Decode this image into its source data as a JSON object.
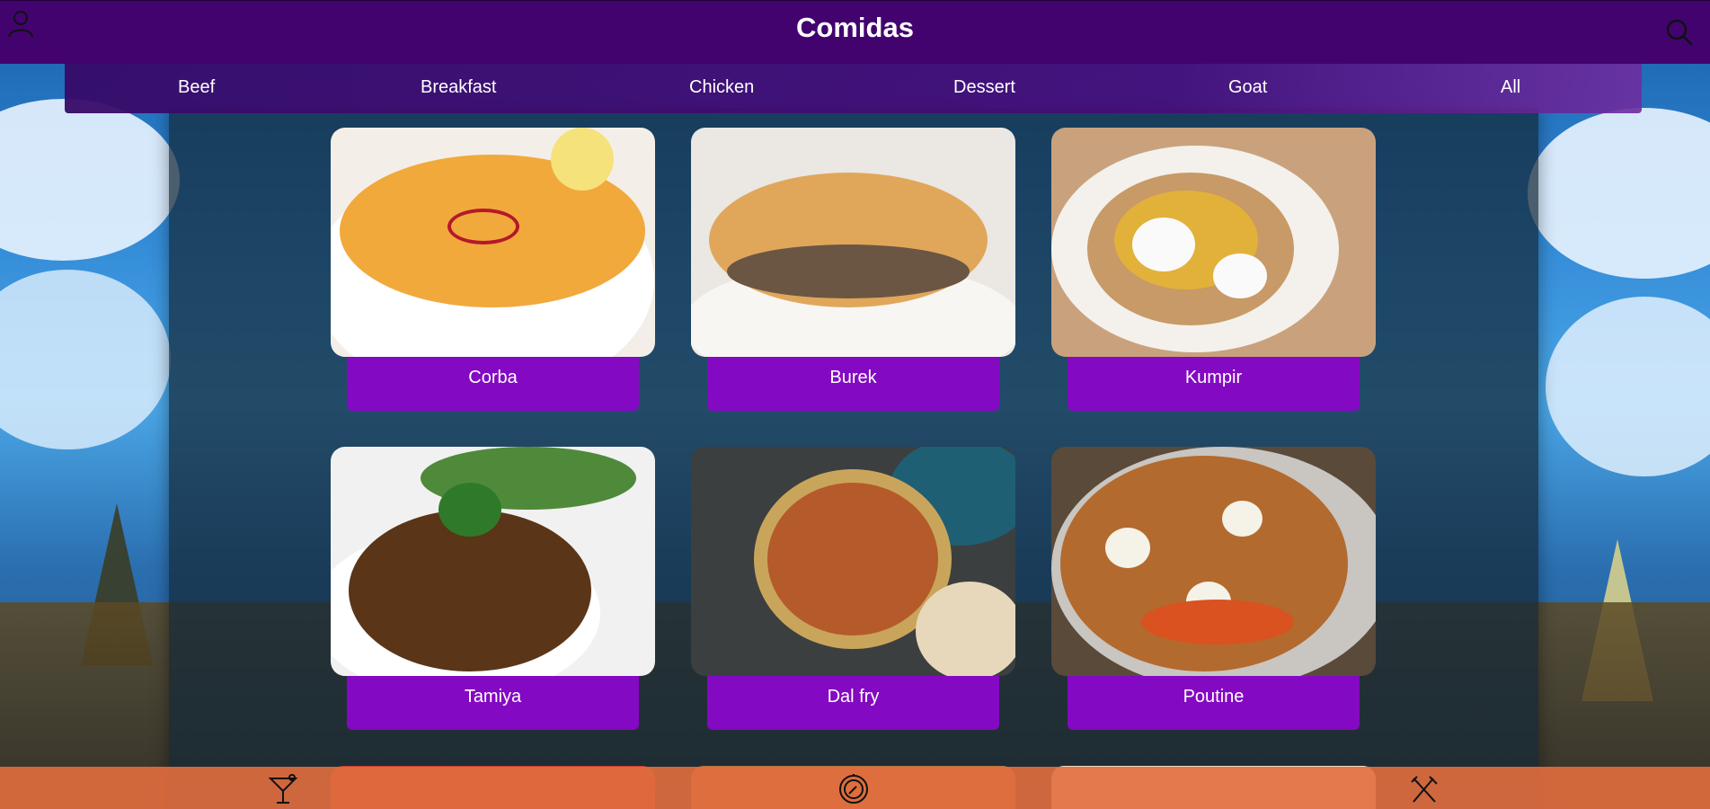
{
  "header": {
    "title": "Comidas"
  },
  "categories": [
    "Beef",
    "Breakfast",
    "Chicken",
    "Dessert",
    "Goat",
    "All"
  ],
  "meals": [
    {
      "name": "Corba"
    },
    {
      "name": "Burek"
    },
    {
      "name": "Kumpir"
    },
    {
      "name": "Tamiya"
    },
    {
      "name": "Dal fry"
    },
    {
      "name": "Poutine"
    }
  ],
  "icons": {
    "profile": "user-icon",
    "search": "search-icon",
    "drinks": "cocktail-icon",
    "explore": "compass-icon",
    "food": "utensils-icon"
  },
  "colors": {
    "header_bg": "#42036f",
    "card_label_bg": "#8409c2",
    "bottom_bar_bg": "#e26e3e"
  }
}
